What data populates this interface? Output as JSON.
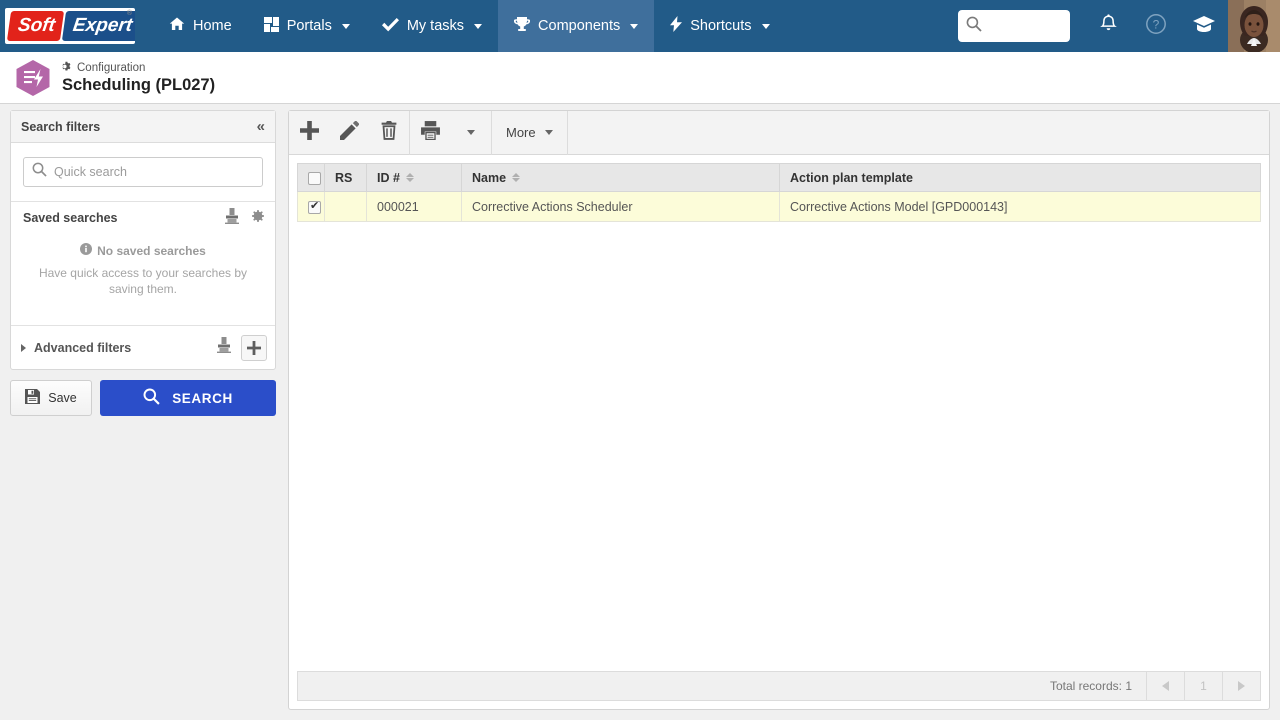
{
  "nav": {
    "logo": {
      "part1": "Soft",
      "part2": "Expert",
      "reg": "®"
    },
    "items": [
      {
        "label": "Home",
        "icon": "home-icon",
        "has_caret": false,
        "active": false
      },
      {
        "label": "Portals",
        "icon": "grid-icon",
        "has_caret": true,
        "active": false
      },
      {
        "label": "My tasks",
        "icon": "check-icon",
        "has_caret": true,
        "active": false
      },
      {
        "label": "Components",
        "icon": "trophy-icon",
        "has_caret": true,
        "active": true
      },
      {
        "label": "Shortcuts",
        "icon": "bolt-icon",
        "has_caret": true,
        "active": false
      }
    ],
    "search": {
      "value": "",
      "placeholder": ""
    },
    "icons": [
      "bell-icon",
      "help-icon",
      "graduation-cap-icon"
    ],
    "avatar": "user-avatar"
  },
  "header": {
    "breadcrumb": "Configuration",
    "breadcrumb_icon": "gear-icon",
    "title": "Scheduling (PL027)",
    "app_icon": "scheduling-hexagon-icon"
  },
  "sidebar": {
    "panel_title": "Search filters",
    "collapse_icon": "«",
    "quick_search": {
      "value": "",
      "placeholder": "Quick search"
    },
    "saved_searches": {
      "title": "Saved searches",
      "empty_title": "No saved searches",
      "empty_hint": "Have quick access to your searches by saving them."
    },
    "advanced_filters": {
      "label": "Advanced filters"
    },
    "save_button": "Save",
    "search_button": "SEARCH"
  },
  "toolbar": {
    "add_label": "+",
    "buttons": [
      "add-icon",
      "edit-icon",
      "delete-icon",
      "print-icon"
    ],
    "more_label": "More"
  },
  "table": {
    "columns": [
      {
        "key": "check",
        "label": "",
        "sortable": false
      },
      {
        "key": "rs",
        "label": "RS",
        "sortable": false
      },
      {
        "key": "id",
        "label": "ID #",
        "sortable": true
      },
      {
        "key": "name",
        "label": "Name",
        "sortable": true
      },
      {
        "key": "template",
        "label": "Action plan template",
        "sortable": false
      }
    ],
    "rows": [
      {
        "checked": true,
        "rs": "",
        "id": "000021",
        "name": "Corrective Actions Scheduler",
        "template": "Corrective Actions Model [GPD000143]"
      }
    ]
  },
  "footer": {
    "total_records": "Total records: 1",
    "page": "1"
  },
  "colors": {
    "nav_bg": "#225b88",
    "nav_active": "#3f6f9c",
    "search_btn": "#2b4ec9",
    "row_highlight": "#fcfcd9",
    "hex_icon": "#b467a8",
    "logo_red": "#e2231a",
    "logo_blue": "#1b4f8a"
  }
}
